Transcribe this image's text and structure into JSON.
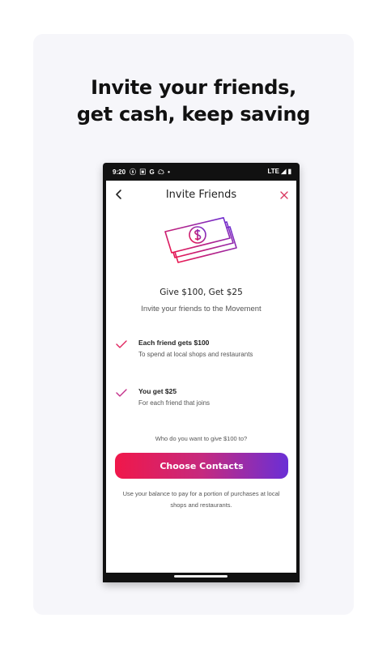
{
  "promo": {
    "headline_line1": "Invite your friends,",
    "headline_line2": "get cash, keep saving"
  },
  "status_bar": {
    "time": "9:20",
    "left_icons": "ⓢ ▣ G ☁ •",
    "right": "LTE ◢ ▮"
  },
  "appbar": {
    "title": "Invite Friends"
  },
  "offer": {
    "title": "Give $100, Get $25",
    "subtitle": "Invite your friends to the Movement"
  },
  "benefits": [
    {
      "title": "Each friend gets $100",
      "description": "To spend at local shops and restaurants"
    },
    {
      "title": "You get $25",
      "description": "For each friend that joins"
    }
  ],
  "question": "Who do you want to give $100 to?",
  "cta_label": "Choose Contacts",
  "footer_note": "Use your balance to pay for a portion of purchases at local shops and restaurants.",
  "colors": {
    "accent_start": "#f0174a",
    "accent_end": "#6a2fd6",
    "check": "#e0245e"
  },
  "icons": [
    "back-arrow-icon",
    "close-icon",
    "money-bills-icon",
    "check-icon"
  ]
}
